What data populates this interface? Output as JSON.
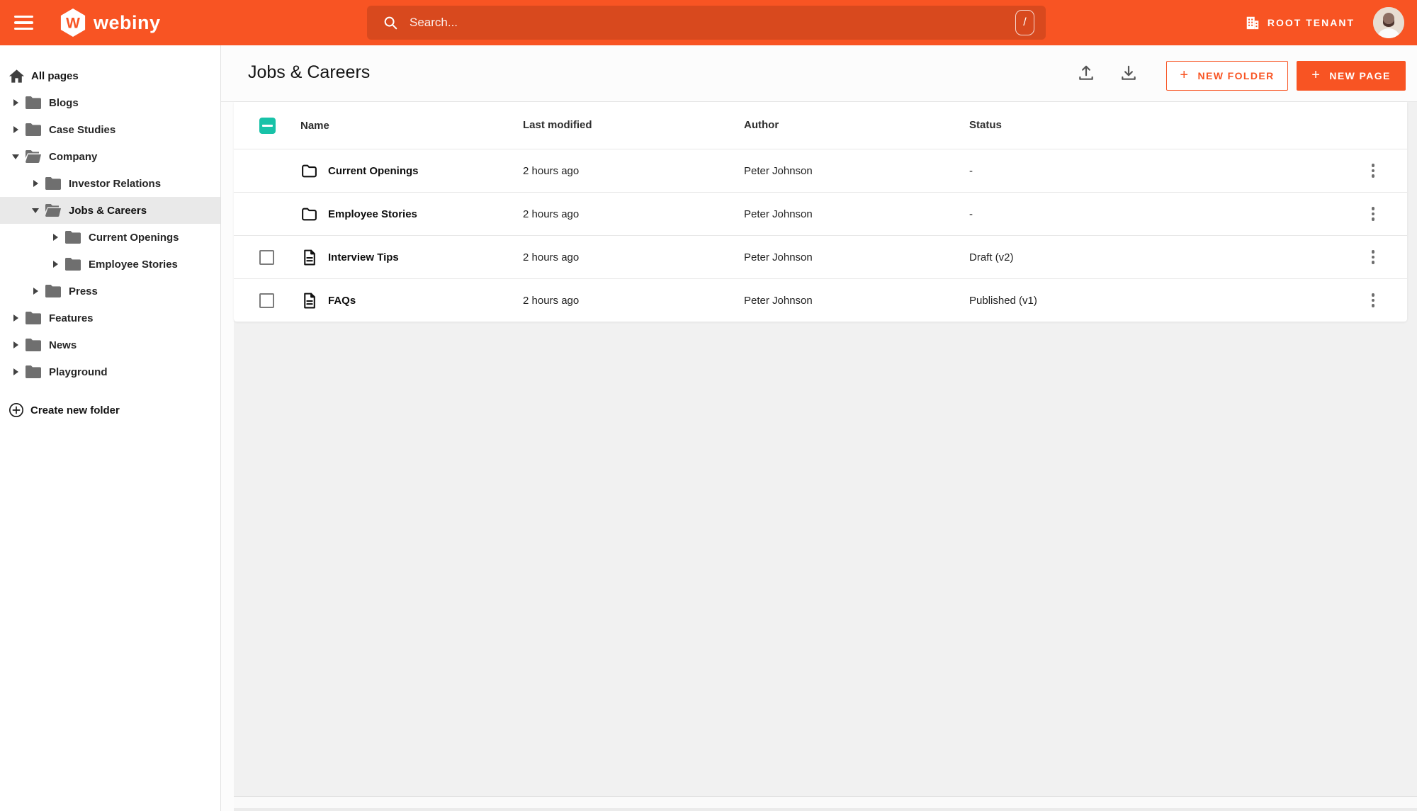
{
  "topbar": {
    "logo_text": "webiny",
    "search": {
      "placeholder": "Search...",
      "shortcut_key": "/"
    },
    "tenant_label": "ROOT TENANT",
    "colors": {
      "bar": "#f85423",
      "search_field": "rgba(0,0,0,0.13)"
    }
  },
  "sidebar": {
    "all_pages_label": "All pages",
    "create_label": "Create new folder",
    "tree": [
      {
        "label": "Blogs",
        "depth": 0,
        "expanded": false,
        "selected": false
      },
      {
        "label": "Case Studies",
        "depth": 0,
        "expanded": false,
        "selected": false
      },
      {
        "label": "Company",
        "depth": 0,
        "expanded": true,
        "selected": false
      },
      {
        "label": "Investor Relations",
        "depth": 1,
        "expanded": false,
        "selected": false
      },
      {
        "label": "Jobs & Careers",
        "depth": 1,
        "expanded": true,
        "selected": true
      },
      {
        "label": "Current Openings",
        "depth": 2,
        "expanded": false,
        "selected": false
      },
      {
        "label": "Employee Stories",
        "depth": 2,
        "expanded": false,
        "selected": false
      },
      {
        "label": "Press",
        "depth": 1,
        "expanded": false,
        "selected": false
      },
      {
        "label": "Features",
        "depth": 0,
        "expanded": false,
        "selected": false
      },
      {
        "label": "News",
        "depth": 0,
        "expanded": false,
        "selected": false
      },
      {
        "label": "Playground",
        "depth": 0,
        "expanded": false,
        "selected": false
      }
    ]
  },
  "main": {
    "title": "Jobs & Careers",
    "toolbar": {
      "new_folder_label": "NEW FOLDER",
      "new_page_label": "NEW PAGE",
      "plus_glyph": "+"
    },
    "table": {
      "columns": [
        "Name",
        "Last modified",
        "Author",
        "Status"
      ],
      "header_checkbox_state": "indeterminate",
      "rows": [
        {
          "type": "folder",
          "name": "Current Openings",
          "modified": "2 hours ago",
          "author": "Peter Johnson",
          "status": "-",
          "has_checkbox": false
        },
        {
          "type": "folder",
          "name": "Employee Stories",
          "modified": "2 hours ago",
          "author": "Peter Johnson",
          "status": "-",
          "has_checkbox": false
        },
        {
          "type": "page",
          "name": "Interview Tips",
          "modified": "2 hours ago",
          "author": "Peter Johnson",
          "status": "Draft (v2)",
          "has_checkbox": true
        },
        {
          "type": "page",
          "name": "FAQs",
          "modified": "2 hours ago",
          "author": "Peter Johnson",
          "status": "Published (v1)",
          "has_checkbox": true
        }
      ]
    }
  },
  "colors": {
    "accent_orange": "#f85423",
    "checkbox_teal": "#18c2a8",
    "selected_row_bg": "#e9e9e9",
    "content_bg": "#f1f1f1"
  }
}
